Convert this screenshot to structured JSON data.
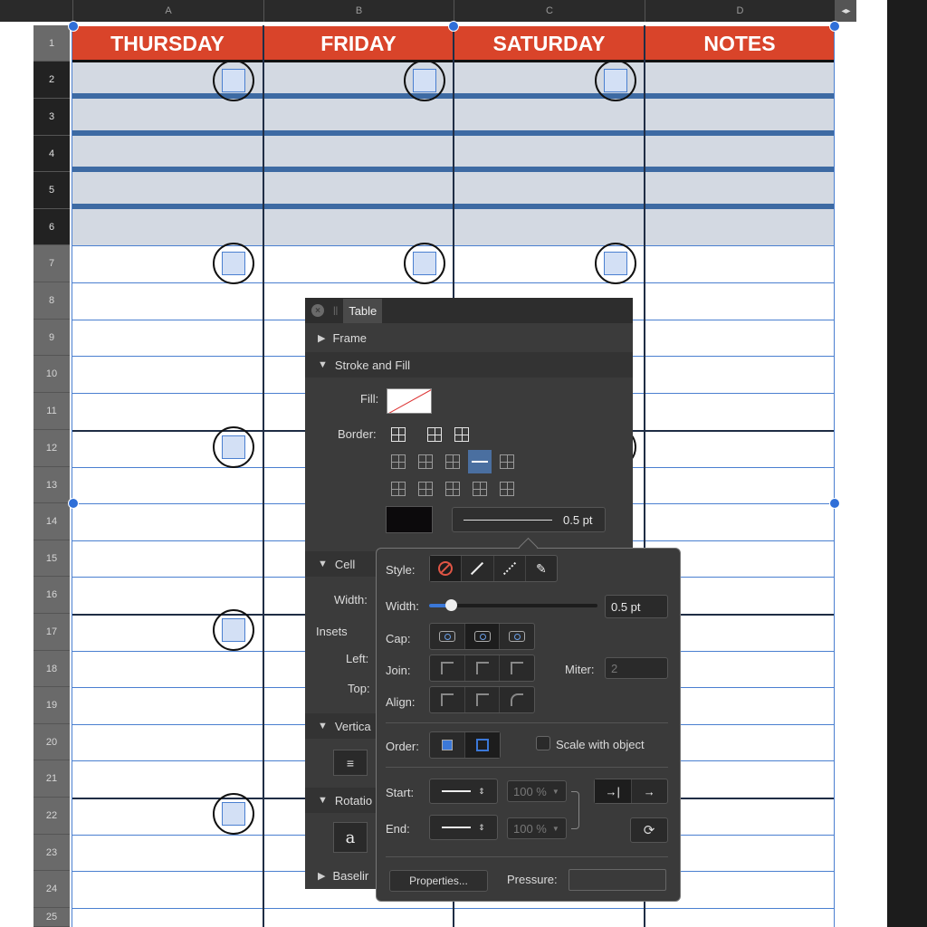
{
  "columns": [
    "A",
    "B",
    "C",
    "D"
  ],
  "rows": [
    "1",
    "2",
    "3",
    "4",
    "5",
    "6",
    "7",
    "8",
    "9",
    "10",
    "11",
    "12",
    "13",
    "14",
    "15",
    "16",
    "17",
    "18",
    "19",
    "20",
    "21",
    "22",
    "23",
    "24",
    "25"
  ],
  "days": [
    "THURSDAY",
    "FRIDAY",
    "SATURDAY",
    "NOTES"
  ],
  "colors": {
    "header_red": "#d9442a",
    "row_shade": "#d3d9e2",
    "selection_blue": "#4a7fd0",
    "panel_bg": "#3b3b3b"
  },
  "table_panel": {
    "title": "Table",
    "sections": {
      "frame": "Frame",
      "stroke_fill": "Stroke and Fill",
      "cell": "Cell",
      "vertical": "Vertica",
      "rotation": "Rotatio",
      "baseline": "Baselir"
    },
    "fill_label": "Fill:",
    "border_label": "Border:",
    "stroke_width_value": "0.5 pt",
    "width_label": "Width:",
    "insets_label": "Insets",
    "left_label": "Left:",
    "top_label": "Top:",
    "rotation_glyph": "a"
  },
  "stroke_popover": {
    "style_label": "Style:",
    "width_label": "Width:",
    "width_value": "0.5 pt",
    "cap_label": "Cap:",
    "join_label": "Join:",
    "miter_label": "Miter:",
    "miter_value": "2",
    "align_label": "Align:",
    "order_label": "Order:",
    "scale_label": "Scale with object",
    "start_label": "Start:",
    "end_label": "End:",
    "start_percent": "100 %",
    "end_percent": "100 %",
    "properties_button": "Properties...",
    "pressure_label": "Pressure:"
  },
  "icons": [
    "close-icon",
    "grip-icon",
    "disclosure-triangle-icon",
    "border-grid-icon",
    "no-stroke-icon",
    "solid-line-icon",
    "dashed-line-icon",
    "brush-icon",
    "cap-icon",
    "join-icon",
    "align-icon",
    "order-icon",
    "arrow-start-icon",
    "swap-icon"
  ]
}
